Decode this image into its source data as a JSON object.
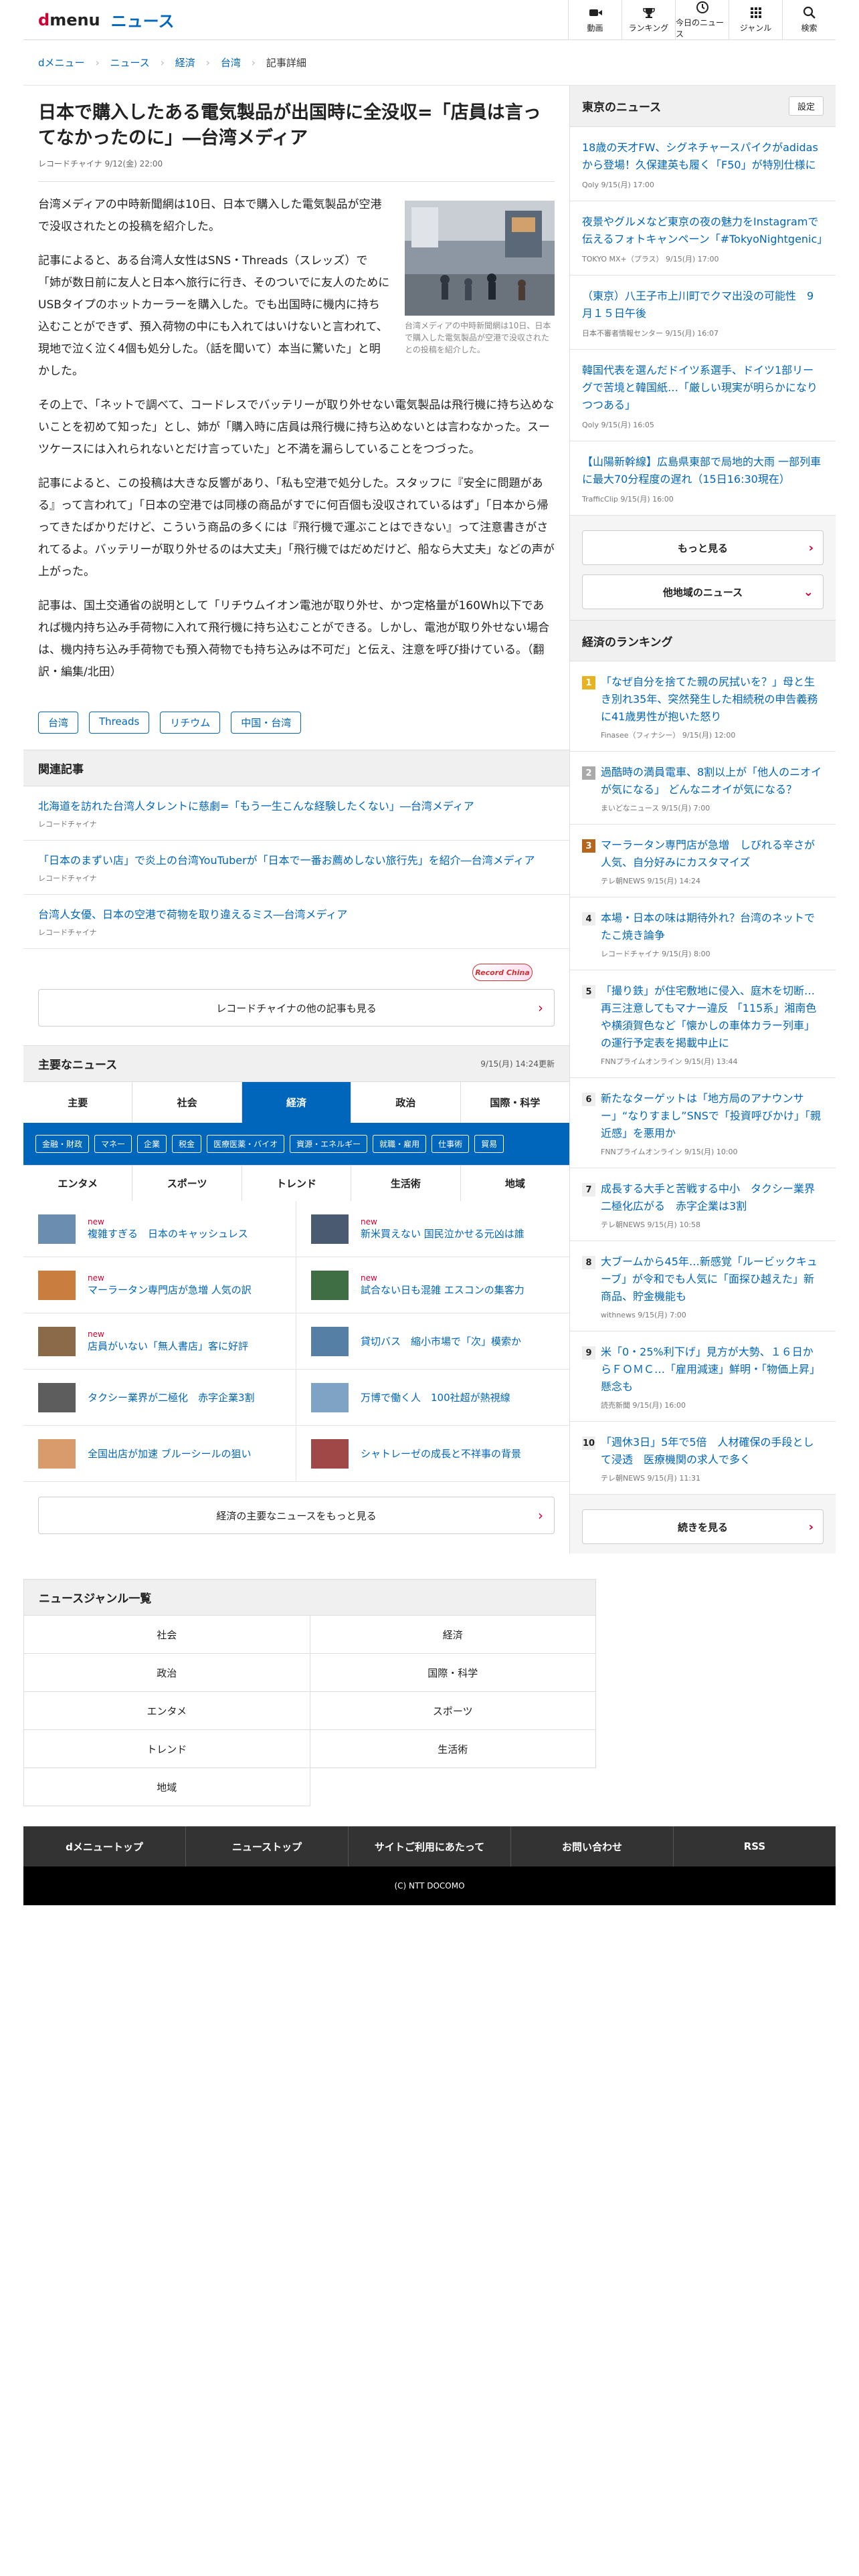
{
  "header": {
    "logo_d": "d",
    "logo_menu": "menu",
    "section": "ニュース",
    "nav": [
      {
        "label": "動画",
        "icon": "video-icon"
      },
      {
        "label": "ランキング",
        "icon": "trophy-icon"
      },
      {
        "label": "今日のニュース",
        "icon": "clock-icon"
      },
      {
        "label": "ジャンル",
        "icon": "grid-icon"
      },
      {
        "label": "検索",
        "icon": "search-icon"
      }
    ]
  },
  "breadcrumb": [
    "dメニュー",
    "ニュース",
    "経済",
    "台湾",
    "記事詳細"
  ],
  "article": {
    "title": "日本で購入したある電気製品が出国時に全没収=「店員は言ってなかったのに」―台湾メディア",
    "meta": "レコードチャイナ 9/12(金) 22:00",
    "caption": "台湾メディアの中時新聞網は10日、日本で購入した電気製品が空港で没収されたとの投稿を紹介した。",
    "paragraphs": [
      "台湾メディアの中時新聞網は10日、日本で購入した電気製品が空港で没収されたとの投稿を紹介した。",
      "記事によると、ある台湾人女性はSNS・Threads（スレッズ）で「姉が数日前に友人と日本へ旅行に行き、そのついでに友人のためにUSBタイプのホットカーラーを購入した。でも出国時に機内に持ち込むことができず、預入荷物の中にも入れてはいけないと言われて、現地で泣く泣く4個も処分した。（話を聞いて）本当に驚いた」と明かした。",
      "その上で、「ネットで調べて、コードレスでバッテリーが取り外せない電気製品は飛行機に持ち込めないことを初めて知った」とし、姉が「購入時に店員は飛行機に持ち込めないとは言わなかった。スーツケースには入れられないとだけ言っていた」と不満を漏らしていることをつづった。",
      "記事によると、この投稿は大きな反響があり、「私も空港で処分した。スタッフに『安全に問題がある』って言われて」「日本の空港では同様の商品がすでに何百個も没収されているはず」「日本から帰ってきたばかりだけど、こういう商品の多くには『飛行機で運ぶことはできない』って注意書きがされてるよ。バッテリーが取り外せるのは大丈夫」「飛行機ではだめだけど、船なら大丈夫」などの声が上がった。",
      "記事は、国土交通省の説明として「リチウムイオン電池が取り外せ、かつ定格量が160Wh以下であれば機内持ち込み手荷物に入れて飛行機に持ち込むことができる。しかし、電池が取り外せない場合は、機内持ち込み手荷物でも預入荷物でも持ち込みは不可だ」と伝え、注意を呼び掛けている。（翻訳・編集/北田）"
    ],
    "tags": [
      "台湾",
      "Threads",
      "リチウム",
      "中国・台湾"
    ]
  },
  "related": {
    "heading": "関連記事",
    "items": [
      {
        "title": "北海道を訪れた台湾人タレントに慈劇=「もう一生こんな経験したくない」―台湾メディア",
        "source": "レコードチャイナ"
      },
      {
        "title": "「日本のまずい店」で炎上の台湾YouTuberが「日本で一番お薦めしない旅行先」を紹介―台湾メディア",
        "source": "レコードチャイナ"
      },
      {
        "title": "台湾人女優、日本の空港で荷物を取り違えるミス―台湾メディア",
        "source": "レコードチャイナ"
      }
    ],
    "logo_text": "Record China",
    "more": "レコードチャイナの他の記事も見る"
  },
  "major": {
    "heading": "主要なニュース",
    "updated": "9/15(月) 14:24更新",
    "tabs": [
      "主要",
      "社会",
      "経済",
      "政治",
      "国際・科学"
    ],
    "active_tab": "経済",
    "subtags": [
      "金融・財政",
      "マネー",
      "企業",
      "税金",
      "医療医薬・バイオ",
      "資源・エネルギー",
      "就職・雇用",
      "仕事術",
      "貿易"
    ],
    "tabs2": [
      "エンタメ",
      "スポーツ",
      "トレンド",
      "生活術",
      "地域"
    ],
    "new_label": "new",
    "items": [
      {
        "title": "複雑すぎる　日本のキャッシュレス",
        "new": true,
        "thumb": "#6b8db0"
      },
      {
        "title": "新米買えない 国民泣かせる元凶は誰",
        "new": true,
        "thumb": "#4a5a70"
      },
      {
        "title": "マーラータン専門店が急増 人気の訳",
        "new": true,
        "thumb": "#c97d3f"
      },
      {
        "title": "試合ない日も混雑 エスコンの集客力",
        "new": true,
        "thumb": "#3f6e45"
      },
      {
        "title": "店員がいない「無人書店」客に好評",
        "new": true,
        "thumb": "#8a6a48"
      },
      {
        "title": "貸切バス　縮小市場で「次」模索か",
        "new": false,
        "thumb": "#567fa6"
      },
      {
        "title": "タクシー業界が二極化　赤字企業3割",
        "new": false,
        "thumb": "#5d5d5d"
      },
      {
        "title": "万博で働く人　100社超が熱視線",
        "new": false,
        "thumb": "#7fa3c4"
      },
      {
        "title": "全国出店が加速 ブルーシールの狙い",
        "new": false,
        "thumb": "#d99a6c"
      },
      {
        "title": "シャトレーゼの成長と不祥事の背景",
        "new": false,
        "thumb": "#a04848"
      }
    ],
    "more": "経済の主要なニュースをもっと見る"
  },
  "genre": {
    "heading": "ニュースジャンル一覧",
    "items": [
      "社会",
      "経済",
      "政治",
      "国際・科学",
      "エンタメ",
      "スポーツ",
      "トレンド",
      "生活術",
      "地域"
    ]
  },
  "footer": {
    "nav": [
      "dメニュートップ",
      "ニューストップ",
      "サイトご利用にあたって",
      "お問い合わせ",
      "RSS"
    ],
    "copyright": "(C) NTT DOCOMO"
  },
  "sidebar": {
    "tokyo_heading": "東京のニュース",
    "settings": "設定",
    "tokyo_items": [
      {
        "title": "18歳の天才FW、シグネチャースパイクがadidasから登場！久保建英も履く「F50」が特別仕様に",
        "source": "Qoly 9/15(月) 17:00"
      },
      {
        "title": "夜景やグルメなど東京の夜の魅力をInstagramで伝えるフォトキャンペーン「#TokyoNightgenic」",
        "source": "TOKYO MX+（プラス） 9/15(月) 17:00"
      },
      {
        "title": "（東京）八王子市上川町でクマ出没の可能性　9月１５日午後",
        "source": "日本不審者情報センター 9/15(月) 16:07"
      },
      {
        "title": "韓国代表を選んだドイツ系選手、ドイツ1部リーグで苦境と韓国紙…「厳しい現実が明らかになりつつある」",
        "source": "Qoly 9/15(月) 16:05"
      },
      {
        "title": "【山陽新幹線】広島県東部で局地的大雨 一部列車に最大70分程度の遅れ（15日16:30現在）",
        "source": "TrafficClip 9/15(月) 16:00"
      }
    ],
    "more": "もっと見る",
    "other_regions": "他地域のニュース",
    "ranking_heading": "経済のランキング",
    "ranking": [
      {
        "title": "「なぜ自分を捨てた親の尻拭いを？」母と生き別れ35年、突然発生した相続税の申告義務に41歳男性が抱いた怒り",
        "source": "Finasee（フィナシー） 9/15(月) 12:00"
      },
      {
        "title": "過酷時の満員電車、8割以上が「他人のニオイが気になる」 どんなニオイが気になる？",
        "source": "まいどなニュース 9/15(月) 7:00"
      },
      {
        "title": "マーラータン専門店が急増　しびれる辛さが人気、自分好みにカスタマイズ",
        "source": "テレ朝NEWS 9/15(月) 14:24"
      },
      {
        "title": "本場・日本の味は期待外れ？台湾のネットでたこ焼き論争",
        "source": "レコードチャイナ 9/15(月) 8:00"
      },
      {
        "title": "「撮り鉄」が住宅敷地に侵入、庭木を切断…再三注意してもマナー違反 「115系」湘南色や横須賀色など「懐かしの車体カラー列車」の運行予定表を掲載中止に",
        "source": "FNNプライムオンライン 9/15(月) 13:44"
      },
      {
        "title": "新たなターゲットは「地方局のアナウンサー」“なりすまし”SNSで「投資呼びかけ」「親近感」を悪用か",
        "source": "FNNプライムオンライン 9/15(月) 10:00"
      },
      {
        "title": "成長する大手と苦戦する中小　タクシー業界二極化広がる　赤字企業は3割",
        "source": "テレ朝NEWS 9/15(月) 10:58"
      },
      {
        "title": "大ブームから45年…新感覚「ルービックキューブ」が令和でも人気に「面探ひ越えた」新商品、貯金機能も",
        "source": "withnews 9/15(月) 7:00"
      },
      {
        "title": "米「0・25%利下げ」見方が大勢、１６日からＦＯＭＣ…「雇用減速」鮮明・「物価上昇」懸念も",
        "source": "読売新聞 9/15(月) 16:00"
      },
      {
        "title": "「週休3日」5年で5倍　人材確保の手段として浸透　医療機関の求人で多く",
        "source": "テレ朝NEWS 9/15(月) 11:31"
      }
    ],
    "ranking_more": "続きを見る"
  }
}
